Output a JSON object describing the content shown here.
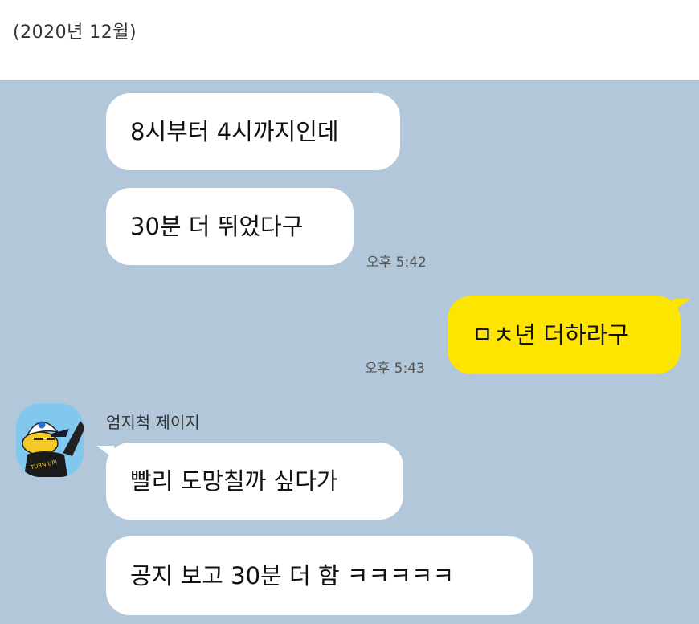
{
  "caption": "(2020년 12월)",
  "messages": [
    {
      "text": "8시부터 4시까지인데",
      "direction": "in"
    },
    {
      "text": "30분 더 뛰었다구",
      "direction": "in",
      "time": "오후 5:42"
    },
    {
      "text": "ㅁㅊ년 더하라구",
      "direction": "out",
      "time": "오후 5:43"
    },
    {
      "text": "빨리 도망칠까 싶다가",
      "direction": "in"
    },
    {
      "text": "공지 보고 30분 더 함 ㅋㅋㅋㅋㅋ",
      "direction": "in"
    }
  ],
  "sender": {
    "name": "엄지척 제이지",
    "avatar_icon": "cartoon-character-avatar-icon",
    "avatar_shirt_text": "TURN UP!"
  },
  "colors": {
    "chat_background": "#b2c7d9",
    "incoming_bubble": "#ffffff",
    "outgoing_bubble": "#fee500",
    "avatar_background": "#82c8ee"
  }
}
